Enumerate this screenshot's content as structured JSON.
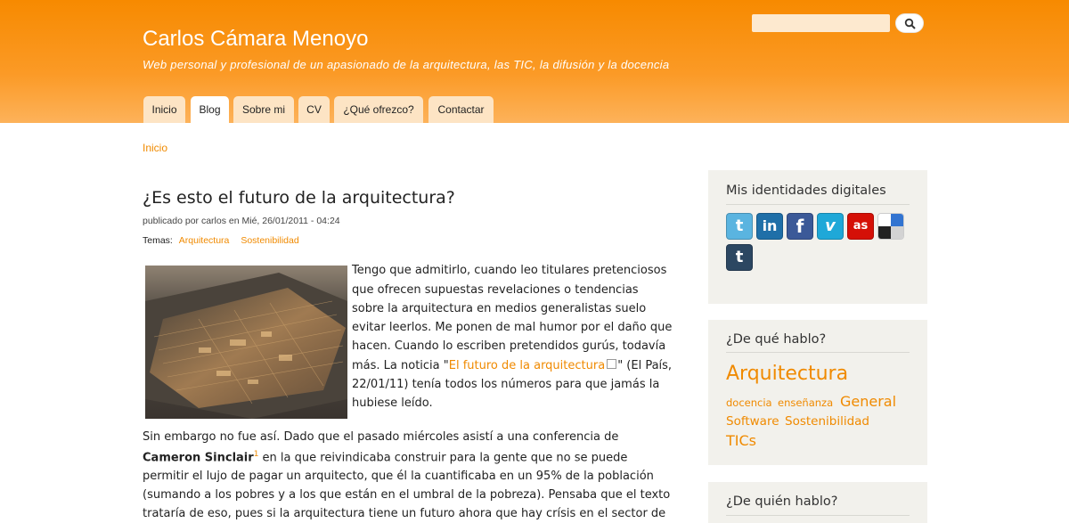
{
  "header": {
    "site_name": "Carlos Cámara Menoyo",
    "slogan": "Web personal y profesional de un apasionado de la arquitectura, las TIC, la difusión y la docencia",
    "search": {
      "value": "",
      "icon": "search-icon"
    },
    "colors": {
      "header_top": "#f78a00",
      "header_bottom": "#fdb25a",
      "tab": "#fde4c4",
      "accent": "#f08a00"
    }
  },
  "nav": {
    "tabs": [
      {
        "label": "Inicio",
        "active": false
      },
      {
        "label": "Blog",
        "active": true
      },
      {
        "label": "Sobre mi",
        "active": false
      },
      {
        "label": "CV",
        "active": false
      },
      {
        "label": "¿Qué ofrezco?",
        "active": false
      },
      {
        "label": "Contactar",
        "active": false
      }
    ]
  },
  "breadcrumb": {
    "home": "Inicio"
  },
  "post": {
    "title": "¿Es esto el futuro de la arquitectura?",
    "submitted": "publicado por carlos en Mié, 26/01/2011 - 04:24",
    "terms_label": "Temas:",
    "terms": [
      "Arquitectura",
      "Sostenibilidad"
    ],
    "body": {
      "l1": "Tengo que admitirlo, cuando leo titulares pretenciosos",
      "l2": "que ofrecen supuestas revelaciones o tendencias",
      "l3": "sobre la arquitectura en medios generalistas suelo",
      "l4": "evitar leerlos. Me ponen de mal humor por el daño que",
      "l5": "hacen. Cuando lo escriben pretendidos gurús, todavía",
      "l6_pre": "más. La noticia \"",
      "l6_link": "El futuro de la arquitectura",
      "l6_post": "\" (El País,",
      "l7": "22/01/11) tenía todos los números para que jamás la",
      "l8": "hubiese leído.",
      "p2_l1": "Sin embargo no fue así. Dado que el pasado miércoles asistí a una conferencia de",
      "p2_l2_bold": "Cameron Sinclair",
      "p2_l2_sup": "1",
      "p2_l2_rest": " en la que reivindicaba construir para la gente que no se puede",
      "p2_l3": "permitir el lujo de pagar un arquitecto, que él la cuantificaba en un 95% de la población",
      "p2_l4": "(sumando a los pobres y a los que están en el umbral de la pobreza). Pensaba que el texto",
      "p2_l5": "trataría de eso, pues si la arquitectura tiene un futuro ahora que hay crísis en el sector de"
    }
  },
  "sidebar": {
    "identities": {
      "title": "Mis identidades digitales",
      "icons": [
        {
          "name": "twitter-icon",
          "glyph": "t",
          "color": "#5ab4e0"
        },
        {
          "name": "linkedin-icon",
          "glyph": "in",
          "color": "#1f6fa8"
        },
        {
          "name": "facebook-icon",
          "glyph": "f",
          "color": "#3b5998"
        },
        {
          "name": "vimeo-icon",
          "glyph": "v",
          "color": "#1fa8d8"
        },
        {
          "name": "lastfm-icon",
          "glyph": "as",
          "color": "#d51007"
        },
        {
          "name": "delicious-icon",
          "glyph": "",
          "color": "#ffffff"
        },
        {
          "name": "tumblr-icon",
          "glyph": "t",
          "color": "#2c4762"
        }
      ]
    },
    "topics": {
      "title": "¿De qué hablo?",
      "tags": {
        "arquitectura": "Arquitectura",
        "docencia": "docencia",
        "ensenanza": "enseñanza",
        "general": "General",
        "software": "Software",
        "sostenibilidad": "Sostenibilidad",
        "tics": "TICs"
      }
    },
    "who": {
      "title": "¿De quién hablo?"
    }
  }
}
